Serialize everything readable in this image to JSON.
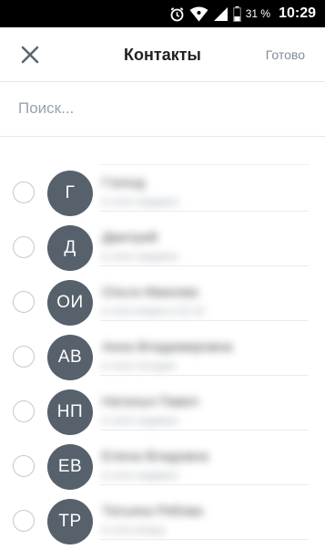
{
  "status_bar": {
    "battery_percent": "31 %",
    "time": "10:29",
    "icons": [
      "alarm-icon",
      "wifi-icon",
      "signal-icon",
      "battery-icon"
    ]
  },
  "toolbar": {
    "close_icon": "close-icon",
    "title": "Контакты",
    "done_label": "Готово"
  },
  "search": {
    "placeholder": "Поиск..."
  },
  "contacts": [
    {
      "initials": "Г",
      "name": "Гзоход",
      "sub": "в сети недавно"
    },
    {
      "initials": "Д",
      "name": "Дмитрий",
      "sub": "в сети недавно"
    },
    {
      "initials": "ОИ",
      "name": "Ольга Иванова",
      "sub": "в сети вчера в 22:10"
    },
    {
      "initials": "АВ",
      "name": "Анна Владимировна",
      "sub": "в сети сегодня"
    },
    {
      "initials": "НП",
      "name": "Наталья Павел",
      "sub": "в сети недавно"
    },
    {
      "initials": "ЕВ",
      "name": "Елена Владовна",
      "sub": "в сети недавно"
    },
    {
      "initials": "ТР",
      "name": "Татьяна Рябова",
      "sub": "в сети вчера"
    }
  ],
  "colors": {
    "avatar_bg": "#56616c",
    "accent_text": "#818c99"
  }
}
